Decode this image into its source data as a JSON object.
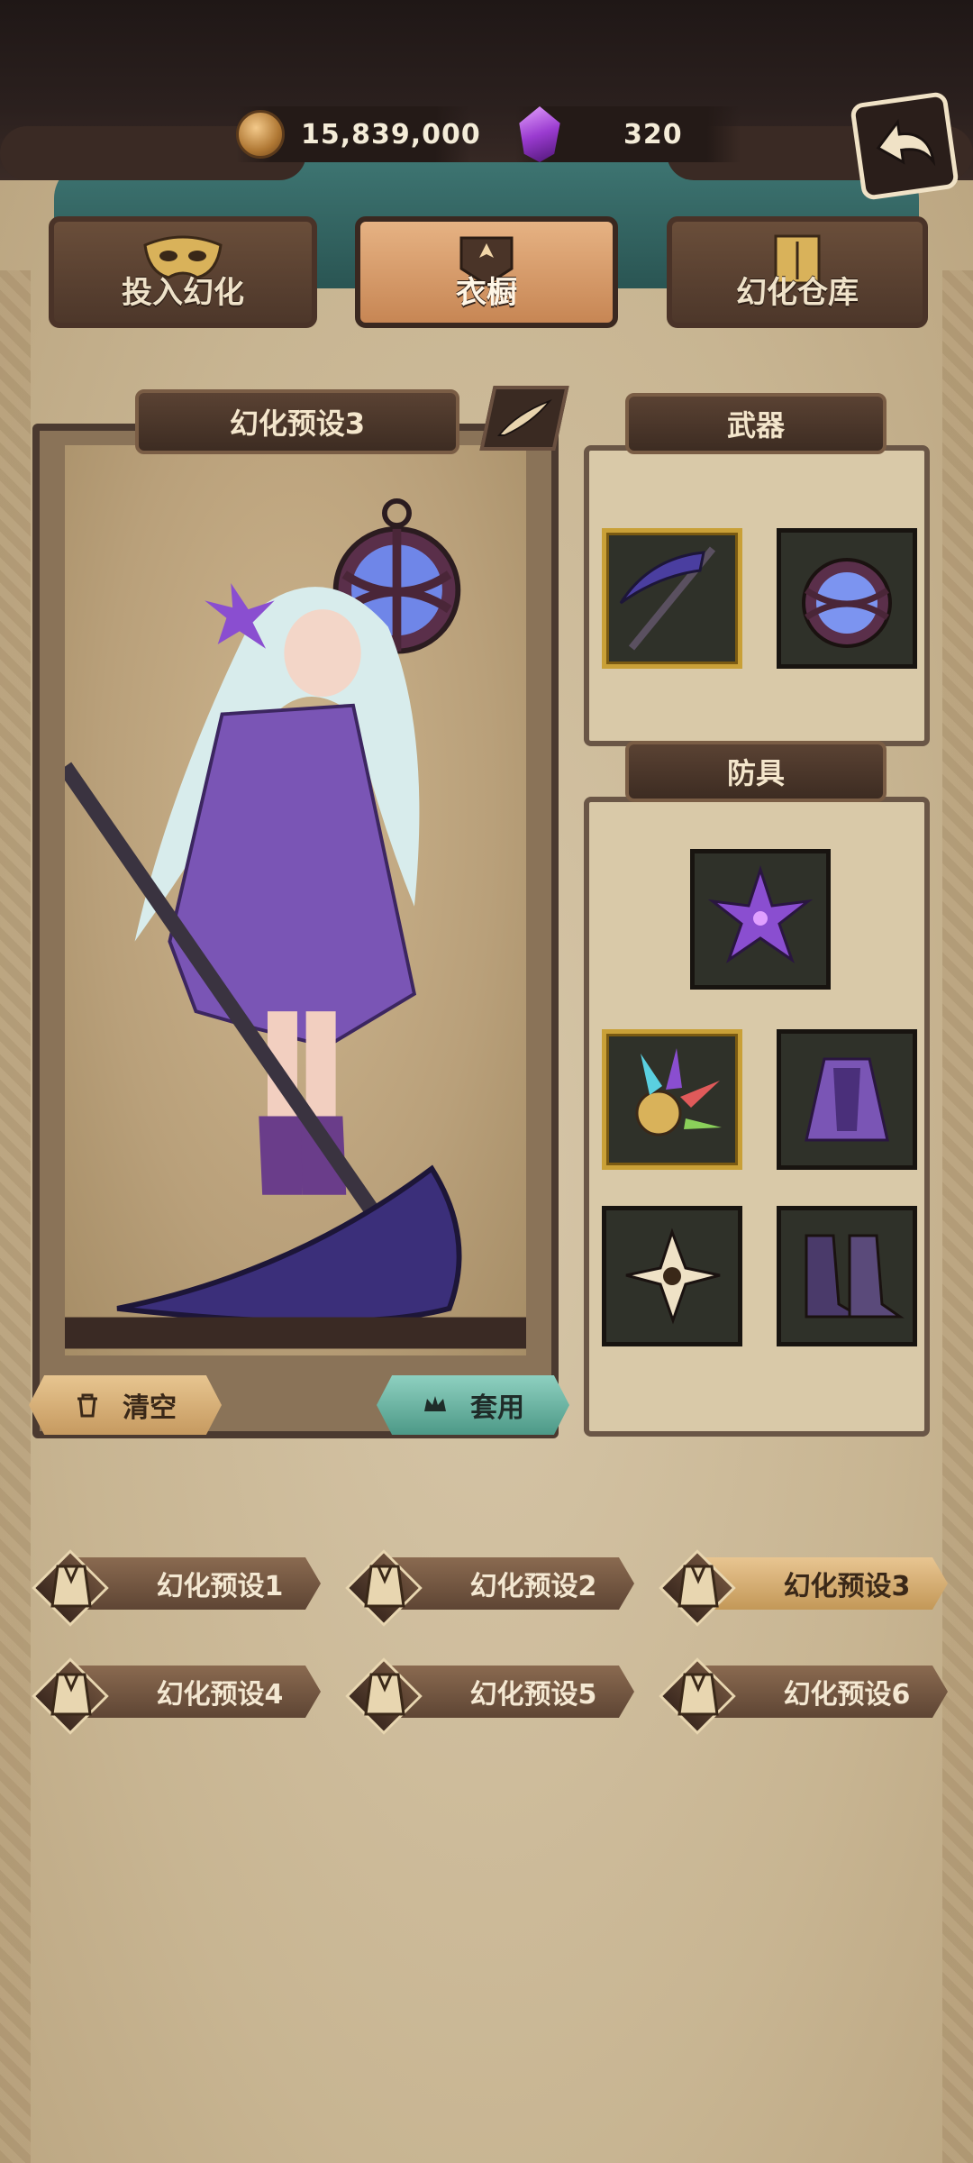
{
  "currency": {
    "gold": "15,839,000",
    "gems": "320"
  },
  "tabs": [
    {
      "label": "投入幻化",
      "active": false,
      "icon": "mask-icon"
    },
    {
      "label": "衣橱",
      "active": true,
      "icon": "wardrobe-crest-icon"
    },
    {
      "label": "幻化仓库",
      "active": false,
      "icon": "cabinet-icon"
    }
  ],
  "preview": {
    "title": "幻化预设3",
    "clear_label": "清空",
    "apply_label": "套用"
  },
  "weapons": {
    "title": "武器",
    "slots": [
      "scythe-icon",
      "lantern-icon"
    ]
  },
  "armor": {
    "title": "防具",
    "slots": [
      "purple-flower-icon",
      "crystal-accessory-icon",
      "purple-cloak-icon",
      "white-flower-icon",
      "dark-boots-icon"
    ]
  },
  "presets": [
    {
      "label": "幻化预设1",
      "active": false
    },
    {
      "label": "幻化预设2",
      "active": false
    },
    {
      "label": "幻化预设3",
      "active": true
    },
    {
      "label": "幻化预设4",
      "active": false
    },
    {
      "label": "幻化预设5",
      "active": false
    },
    {
      "label": "幻化预设6",
      "active": false
    }
  ],
  "colors": {
    "accent_gold": "#c9a037",
    "teal_button": "#4d9987",
    "parchment": "#cdbb9c"
  }
}
